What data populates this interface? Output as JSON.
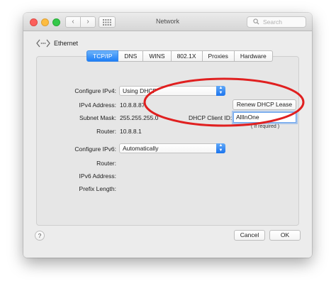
{
  "window": {
    "title": "Network",
    "search_placeholder": "Search",
    "nav_back": "‹",
    "nav_forward": "›"
  },
  "header": {
    "back_label": "Ethernet"
  },
  "tabs": [
    {
      "label": "TCP/IP",
      "active": true
    },
    {
      "label": "DNS"
    },
    {
      "label": "WINS"
    },
    {
      "label": "802.1X"
    },
    {
      "label": "Proxies"
    },
    {
      "label": "Hardware"
    }
  ],
  "ipv4": {
    "configure_label": "Configure IPv4:",
    "configure_value": "Using DHCP",
    "address_label": "IPv4 Address:",
    "address_value": "10.8.8.87",
    "subnet_label": "Subnet Mask:",
    "subnet_value": "255.255.255.0",
    "router_label": "Router:",
    "router_value": "10.8.8.1",
    "renew_button": "Renew DHCP Lease",
    "client_id_label": "DHCP Client ID:",
    "client_id_value": "AllInOne",
    "client_id_note": "( If required )"
  },
  "ipv6": {
    "configure_label": "Configure IPv6:",
    "configure_value": "Automatically",
    "router_label": "Router:",
    "address_label": "IPv6 Address:",
    "prefix_label": "Prefix Length:"
  },
  "footer": {
    "help": "?",
    "cancel": "Cancel",
    "ok": "OK"
  },
  "colors": {
    "annotation_circle": "#e02020",
    "accent": "#1e7ef6"
  }
}
